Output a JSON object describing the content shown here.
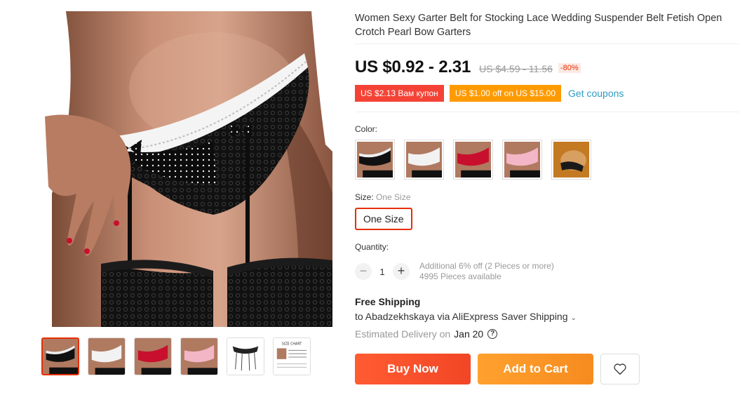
{
  "product": {
    "title": "Women Sexy Garter Belt for Stocking Lace Wedding Suspender Belt Fetish Open Crotch Pearl Bow Garters"
  },
  "gallery": {
    "main_image": "product-photo",
    "thumbnails": [
      "thumb-black",
      "thumb-white",
      "thumb-red",
      "thumb-pink",
      "thumb-garter-flat",
      "thumb-size-chart"
    ],
    "size_chart_text": "SIZE CHART"
  },
  "pricing": {
    "price": "US $0.92 - 2.31",
    "original_price": "US $4.59 - 11.56",
    "discount": "-80%"
  },
  "coupons": {
    "coupon1": "US $2.13 Вам купон",
    "coupon2": "US $1.00 off on US $15.00",
    "get_coupons": "Get coupons"
  },
  "color": {
    "label": "Color:",
    "options": [
      "black",
      "white",
      "red",
      "pink",
      "photo"
    ]
  },
  "size": {
    "label": "Size:",
    "selected_value": "One Size",
    "options": [
      "One Size"
    ]
  },
  "quantity": {
    "label": "Quantity:",
    "minus": "−",
    "value": "1",
    "plus": "+",
    "promo": "Additional 6% off (2 Pieces or more)",
    "available": "4995 Pieces available"
  },
  "shipping": {
    "title": "Free Shipping",
    "to": "to Abadzekhskaya via AliExpress Saver Shipping",
    "chevron": "⌄",
    "estimate_label": "Estimated Delivery on",
    "estimate_date": "Jan 20",
    "help": "?"
  },
  "actions": {
    "buy_now": "Buy Now",
    "add_to_cart": "Add to Cart"
  },
  "colors": {
    "accent_red": "#e62e04",
    "buy_gradient": "#f24626",
    "cart_gradient": "#f68b1f",
    "link": "#2e9cc3"
  }
}
